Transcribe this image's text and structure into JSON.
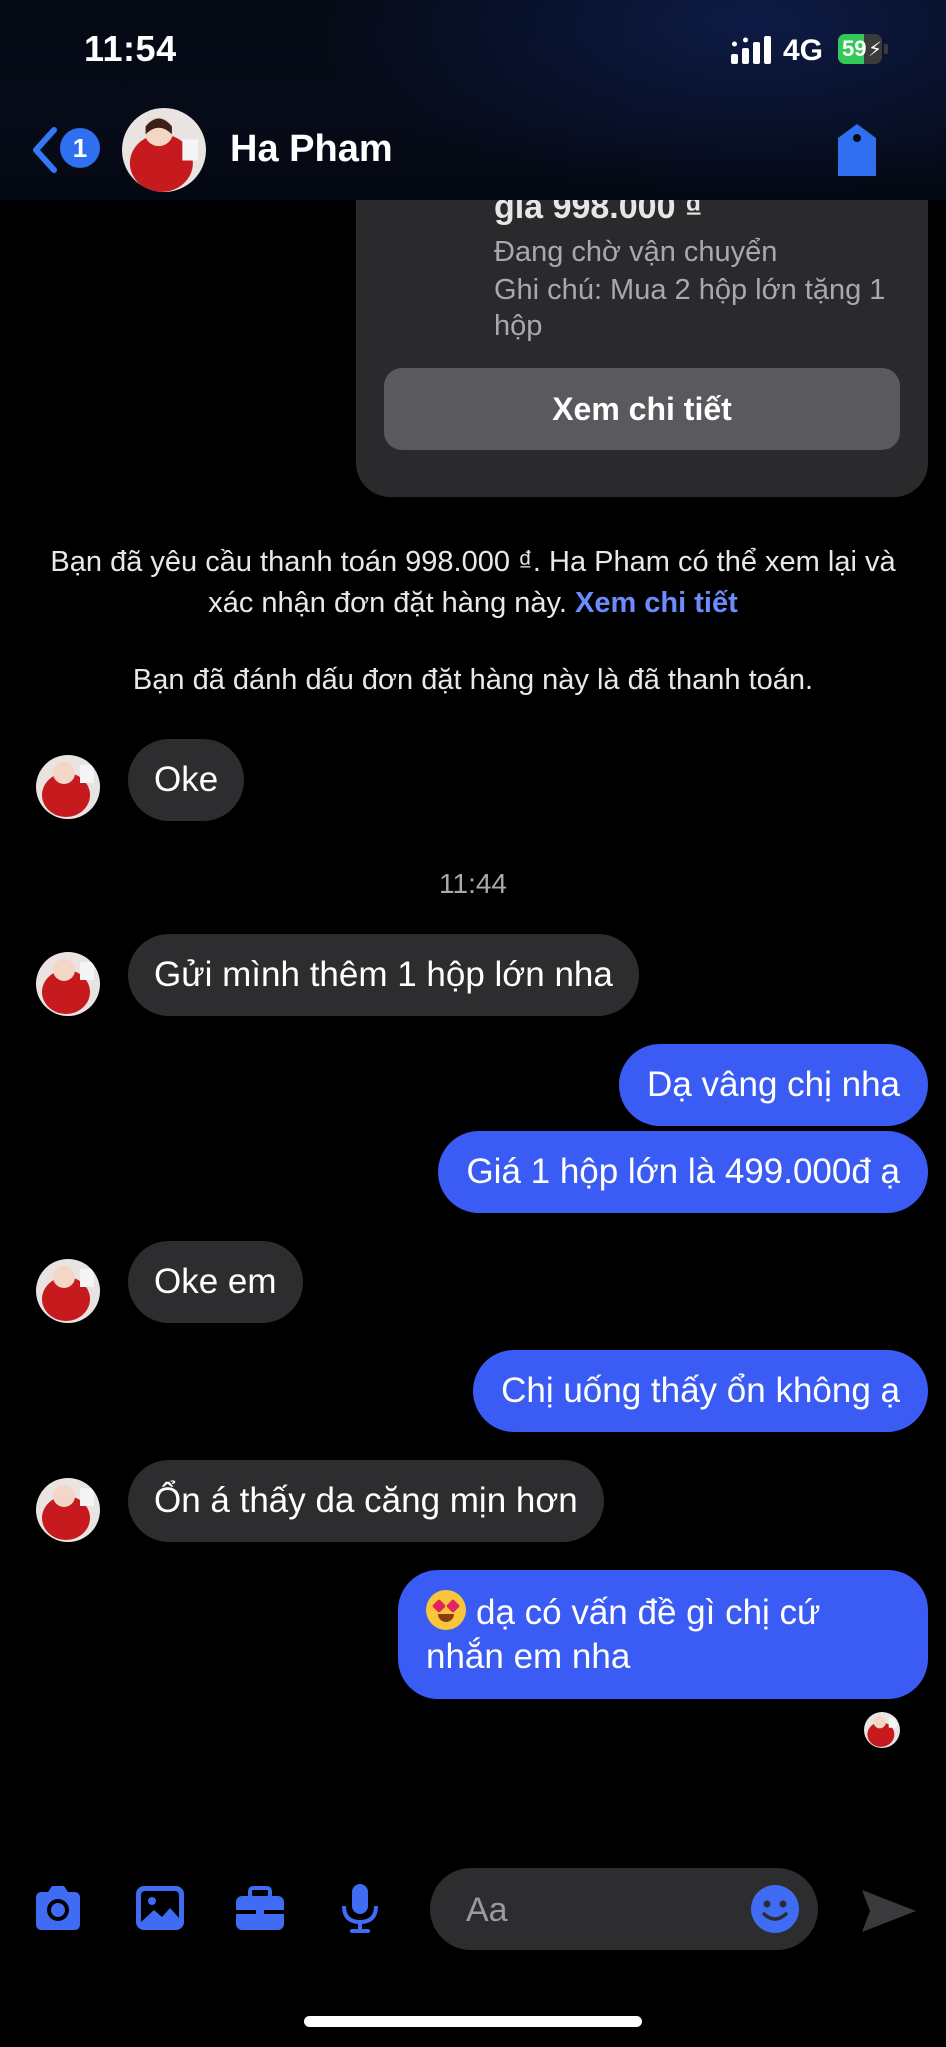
{
  "status_bar": {
    "time": "11:54",
    "network": "4G",
    "battery_percent": 59,
    "battery_label": "59"
  },
  "header": {
    "back_badge": "1",
    "contact_name": "Ha Pham",
    "icons": [
      "chevron-left-icon",
      "tag-icon"
    ]
  },
  "order_card": {
    "price": "giá 998.000 ₫",
    "status": "Đang chờ vận chuyển",
    "note": "Ghi chú: Mua 2 hộp lớn tặng 1 hộp",
    "button_label": "Xem chi tiết"
  },
  "system_messages": {
    "payment_request": "Bạn đã yêu cầu thanh toán 998.000 ₫. Ha Pham có thể xem lại và xác nhận đơn đặt hàng này.",
    "payment_request_link": "Xem chi tiết",
    "marked_paid": "Bạn đã đánh dấu đơn đặt hàng này là đã thanh toán.",
    "time_separator": "11:44"
  },
  "messages": [
    {
      "side": "in",
      "text": "Oke"
    },
    {
      "side": "in",
      "text": "Gửi mình thêm 1 hộp lớn nha"
    },
    {
      "side": "out",
      "text": "Dạ vâng chị nha"
    },
    {
      "side": "out",
      "text": "Giá 1 hộp lớn là 499.000đ ạ"
    },
    {
      "side": "in",
      "text": "Oke em"
    },
    {
      "side": "out",
      "text": "Chị uống thấy ổn không ạ"
    },
    {
      "side": "in",
      "text": "Ổn á thấy da căng mịn hơn"
    },
    {
      "side": "out",
      "emoji": "heart-eyes-emoji",
      "text": "dạ có vấn đề gì chị cứ nhắn em nha"
    }
  ],
  "composer": {
    "placeholder": "Aa",
    "tools": [
      "camera-icon",
      "image-icon",
      "briefcase-icon",
      "microphone-icon"
    ],
    "emoji_button": "smiley-icon",
    "send_button": "send-icon"
  },
  "colors": {
    "outgoing_bubble": "#3a5cf5",
    "incoming_bubble": "#2d2d2f",
    "accent": "#2f6ff0",
    "link": "#6b8cff",
    "order_badge": "#4cc756"
  }
}
